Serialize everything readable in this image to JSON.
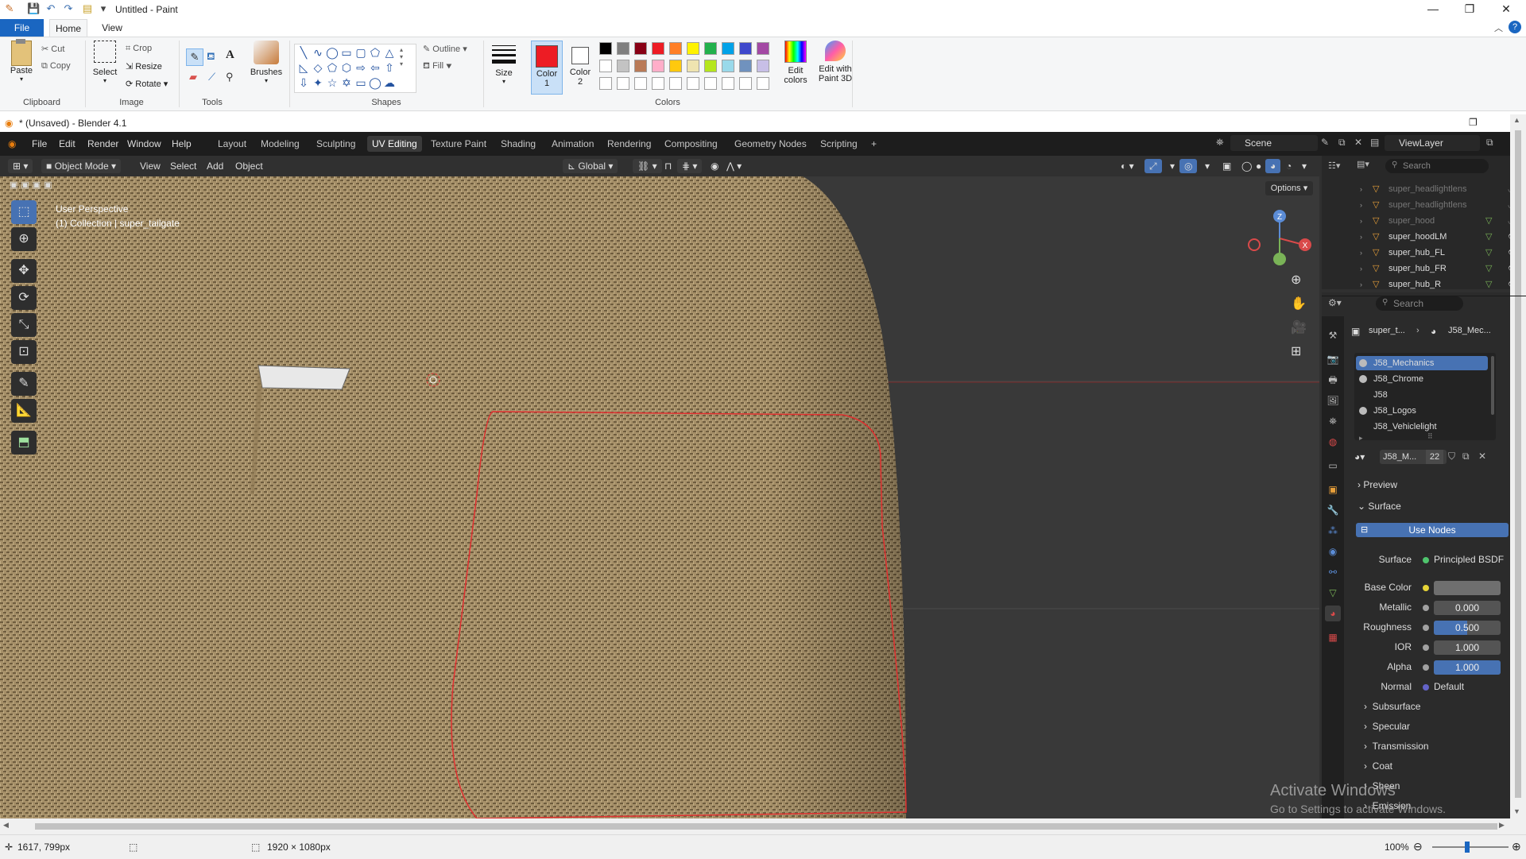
{
  "paint": {
    "title": "Untitled - Paint",
    "tabs": {
      "file": "File",
      "home": "Home",
      "view": "View"
    },
    "clipboard": {
      "paste": "Paste",
      "cut": "Cut",
      "copy": "Copy",
      "label": "Clipboard"
    },
    "image": {
      "select": "Select",
      "crop": "Crop",
      "resize": "Resize",
      "rotate": "Rotate",
      "label": "Image"
    },
    "tools": {
      "label": "Tools"
    },
    "brushes": "Brushes",
    "shapes": {
      "outline": "Outline",
      "fill": "Fill",
      "label": "Shapes"
    },
    "size": "Size",
    "color1": {
      "line1": "Color",
      "line2": "1"
    },
    "color2": {
      "line1": "Color",
      "line2": "2"
    },
    "colors_label": "Colors",
    "edit_colors": {
      "line1": "Edit",
      "line2": "colors"
    },
    "edit_paint3d": {
      "line1": "Edit with",
      "line2": "Paint 3D"
    },
    "palette_row1": [
      "#000000",
      "#7f7f7f",
      "#880015",
      "#ed1c24",
      "#ff7f27",
      "#fff200",
      "#22b14c",
      "#00a2e8",
      "#3f48cc",
      "#a349a4"
    ],
    "palette_row2": [
      "#ffffff",
      "#c3c3c3",
      "#b97a57",
      "#ffaec9",
      "#ffc90e",
      "#efe4b0",
      "#b5e61d",
      "#99d9ea",
      "#7092be",
      "#c8bfe7"
    ],
    "color1_value": "#ed1c24",
    "status": {
      "cursor": "1617, 799px",
      "size": "1920 × 1080px",
      "zoom": "100%"
    }
  },
  "blender": {
    "title": "* (Unsaved) - Blender 4.1",
    "menu": [
      "File",
      "Edit",
      "Render",
      "Window",
      "Help"
    ],
    "workspaces": [
      "Layout",
      "Modeling",
      "Sculpting",
      "UV Editing",
      "Texture Paint",
      "Shading",
      "Animation",
      "Rendering",
      "Compositing",
      "Geometry Nodes",
      "Scripting",
      "+"
    ],
    "active_workspace": "UV Editing",
    "scene": "Scene",
    "view_layer": "ViewLayer",
    "header": {
      "mode": "Object Mode",
      "view": "View",
      "select": "Select",
      "add": "Add",
      "object": "Object",
      "orientation": "Global",
      "options": "Options"
    },
    "viewport_info": {
      "line1": "User Perspective",
      "line2": "(1) Collection | super_tailgate"
    },
    "gizmo": {
      "z": "Z",
      "x": "X"
    },
    "outliner": {
      "search": "Search",
      "items": [
        "super_headlightlens",
        "super_headlightlens",
        "super_hood",
        "super_hoodLM",
        "super_hub_FL",
        "super_hub_FR",
        "super_hub_R"
      ]
    },
    "props": {
      "search": "Search",
      "breadcrumb_obj": "super_t...",
      "breadcrumb_mat": "J58_Mec...",
      "materials": [
        "J58_Mechanics",
        "J58_Chrome",
        "J58",
        "J58_Logos",
        "J58_Vehiclelight"
      ],
      "material_name": "J58_M...",
      "users": "22",
      "preview": "Preview",
      "surface": "Surface",
      "use_nodes": "Use Nodes",
      "surface_label": "Surface",
      "surface_value": "Principled BSDF",
      "base_color": "Base Color",
      "metallic": {
        "label": "Metallic",
        "value": "0.000"
      },
      "roughness": {
        "label": "Roughness",
        "value": "0.500",
        "fraction": 0.5
      },
      "ior": {
        "label": "IOR",
        "value": "1.000"
      },
      "alpha": {
        "label": "Alpha",
        "value": "1.000",
        "fraction": 1.0
      },
      "normal": {
        "label": "Normal",
        "value": "Default"
      },
      "sections": [
        "Subsurface",
        "Specular",
        "Transmission",
        "Coat",
        "Sheen",
        "Emission"
      ]
    }
  },
  "watermark": {
    "line1": "Activate Windows",
    "line2": "Go to Settings to activate Windows."
  }
}
